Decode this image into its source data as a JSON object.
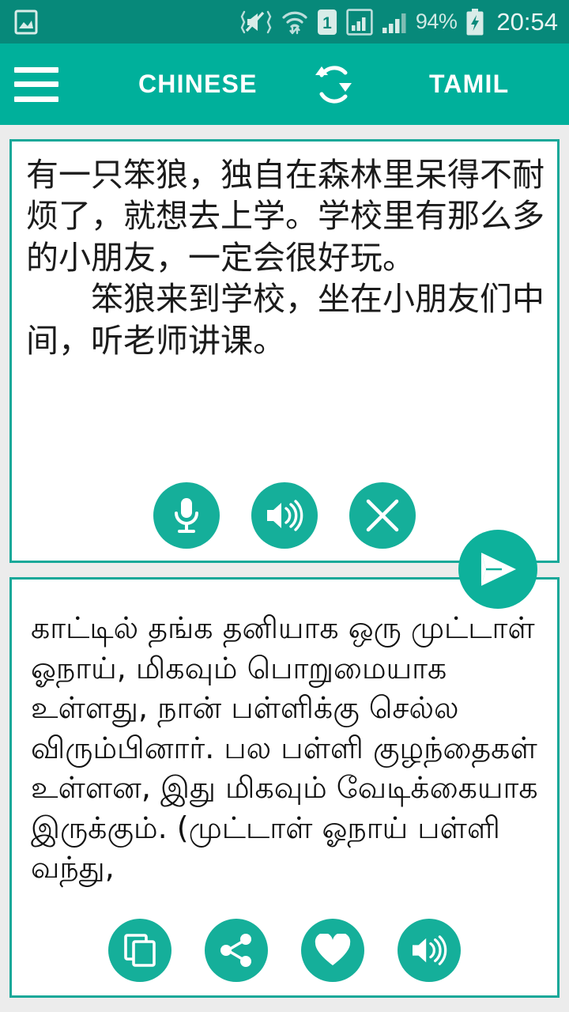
{
  "statusbar": {
    "icons": [
      "gallery-icon",
      "vibrate-mute-icon",
      "wifi-icon",
      "sim1-icon",
      "signal-boxed-icon",
      "signal-icon"
    ],
    "battery_percent": "94%",
    "battery_state": "charging",
    "clock": "20:54"
  },
  "appbar": {
    "menu_icon": "hamburger-menu-icon",
    "source_language": "CHINESE",
    "swap_icon": "swap-languages-icon",
    "target_language": "TAMIL"
  },
  "source_card": {
    "text": "有一只笨狼，独自在森林里呆得不耐烦了，就想去上学。学校里有那么多的小朋友，一定会很好玩。\n　　笨狼来到学校，坐在小朋友们中间，听老师讲课。",
    "buttons": [
      {
        "name": "microphone-button",
        "icon": "microphone-icon",
        "label": "Speak"
      },
      {
        "name": "speak-source-button",
        "icon": "speaker-icon",
        "label": "Listen"
      },
      {
        "name": "clear-button",
        "icon": "close-icon",
        "label": "Clear"
      }
    ]
  },
  "translate_button": {
    "icon": "send-icon",
    "label": "Translate"
  },
  "target_card": {
    "text": "காட்டில் தங்க தனியாக ஒரு முட்டாள் ஓநாய், மிகவும் பொறுமையாக உள்ளது, நான் பள்ளிக்கு செல்ல விரும்பினார். பல பள்ளி குழந்தைகள் உள்ளன, இது மிகவும் வேடிக்கையாக இருக்கும். (முட்டாள் ஓநாய் பள்ளி வந்து,",
    "buttons": [
      {
        "name": "copy-button",
        "icon": "copy-icon",
        "label": "Copy"
      },
      {
        "name": "share-button",
        "icon": "share-icon",
        "label": "Share"
      },
      {
        "name": "favorite-button",
        "icon": "heart-icon",
        "label": "Favorite"
      },
      {
        "name": "speak-target-button",
        "icon": "speaker-icon",
        "label": "Listen"
      }
    ]
  },
  "colors": {
    "statusbar": "#07897a",
    "appbar": "#00b09b",
    "accent": "#15af9a",
    "card_border": "#17a899",
    "page_background": "#ececec",
    "card_background": "#ffffff",
    "text": "#111111"
  }
}
